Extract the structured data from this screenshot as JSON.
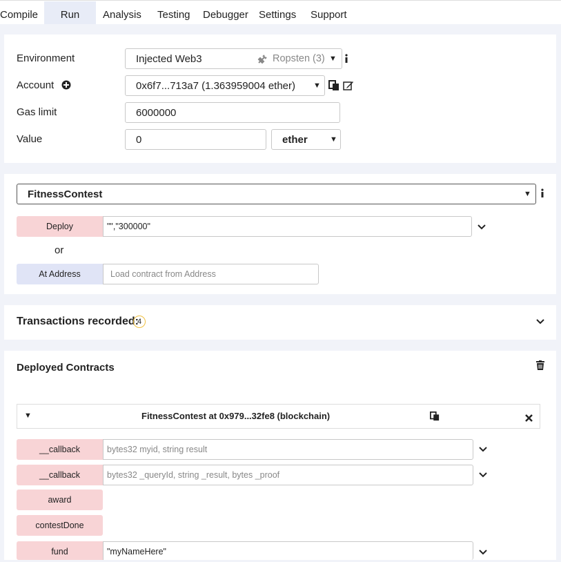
{
  "tabs": [
    {
      "label": "Compile"
    },
    {
      "label": "Run"
    },
    {
      "label": "Analysis"
    },
    {
      "label": "Testing"
    },
    {
      "label": "Debugger"
    },
    {
      "label": "Settings"
    },
    {
      "label": "Support"
    }
  ],
  "settings": {
    "environment_label": "Environment",
    "environment_value": "Injected Web3",
    "network": "Ropsten (3)",
    "account_label": "Account",
    "account_value": "0x6f7...713a7 (1.363959004 ether)",
    "gas_label": "Gas limit",
    "gas_value": "6000000",
    "value_label": "Value",
    "value_value": "0",
    "unit_value": "ether"
  },
  "contract": {
    "selected": "FitnessContest",
    "deploy_label": "Deploy",
    "deploy_args": "\"\",\"300000\"",
    "or_label": "or",
    "at_address_label": "At Address",
    "at_address_placeholder": "Load contract from Address"
  },
  "transactions": {
    "label": "Transactions recorded:",
    "count": "4"
  },
  "deployed": {
    "title": "Deployed Contracts",
    "instance_title": "FitnessContest at 0x979...32fe8 (blockchain)",
    "functions": [
      {
        "label": "__callback",
        "placeholder": "bytes32 myid, string result"
      },
      {
        "label": "__callback",
        "placeholder": "bytes32 _queryId, string _result, bytes _proof"
      },
      {
        "label": "award"
      },
      {
        "label": "contestDone"
      },
      {
        "label": "fund",
        "value": "\"myNameHere\""
      }
    ]
  },
  "colors": {
    "transact_button": "#f8d4d6",
    "call_button": "#e0e4f6",
    "background": "#f1f3f9",
    "badge": "#f0c040"
  }
}
